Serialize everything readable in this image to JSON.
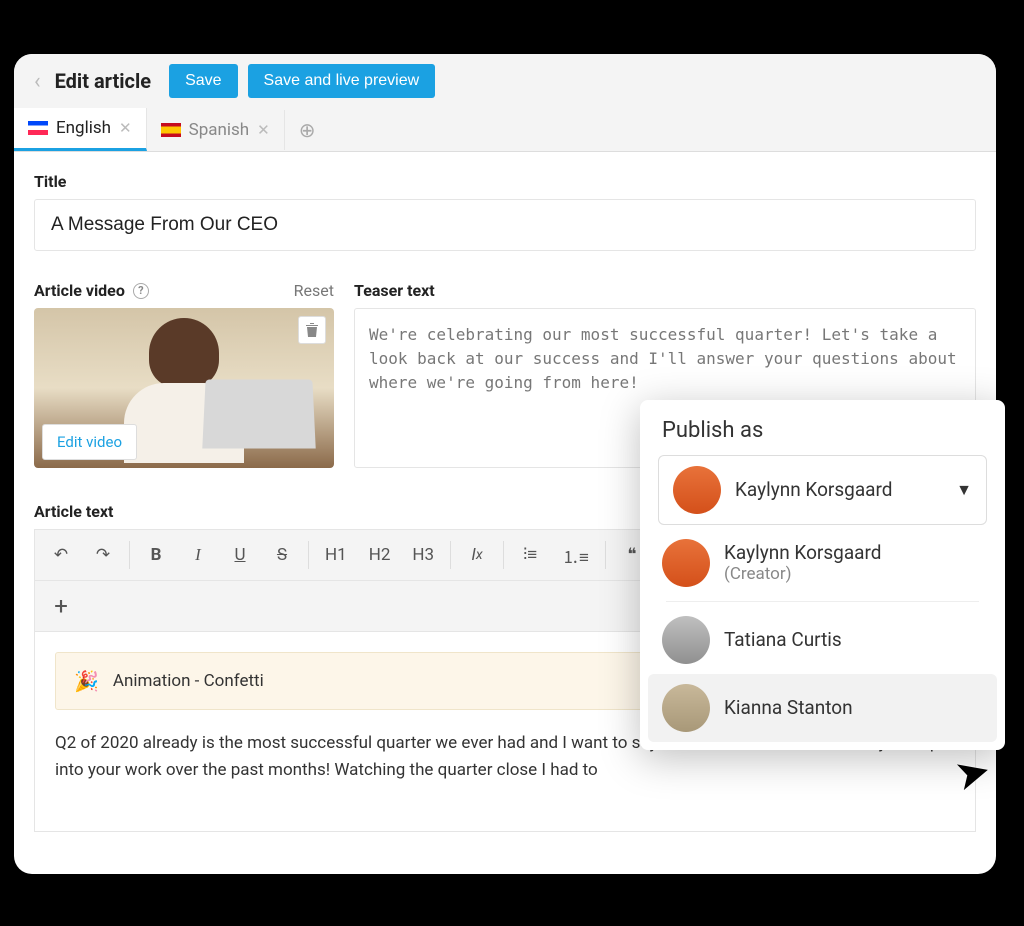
{
  "header": {
    "title": "Edit article",
    "save_label": "Save",
    "save_preview_label": "Save and live preview"
  },
  "tabs": {
    "english": "English",
    "spanish": "Spanish"
  },
  "fields": {
    "title_label": "Title",
    "title_value": "A Message From Our CEO",
    "article_video_label": "Article video",
    "reset_label": "Reset",
    "edit_video_label": "Edit video",
    "teaser_label": "Teaser text",
    "teaser_value": "We're celebrating our most successful quarter! Let's take a look back at our success and I'll answer your questions about where we're going from here!",
    "article_text_label": "Article text"
  },
  "toolbar": {
    "h1": "H1",
    "h2": "H2",
    "h3": "H3",
    "quote": "❝"
  },
  "editor": {
    "animation_label": "Animation - Confetti",
    "body_text": "Q2 of 2020 already is the most successful quarter we ever had and I want to say \"Thank You\" for all the effort you've put into your work over the past months! Watching the quarter close I had to"
  },
  "publish": {
    "heading": "Publish as",
    "selected_name": "Kaylynn Korsgaard",
    "options": [
      {
        "name": "Kaylynn Korsgaard",
        "role": "(Creator)"
      },
      {
        "name": "Tatiana Curtis",
        "role": ""
      },
      {
        "name": "Kianna Stanton",
        "role": ""
      }
    ]
  }
}
